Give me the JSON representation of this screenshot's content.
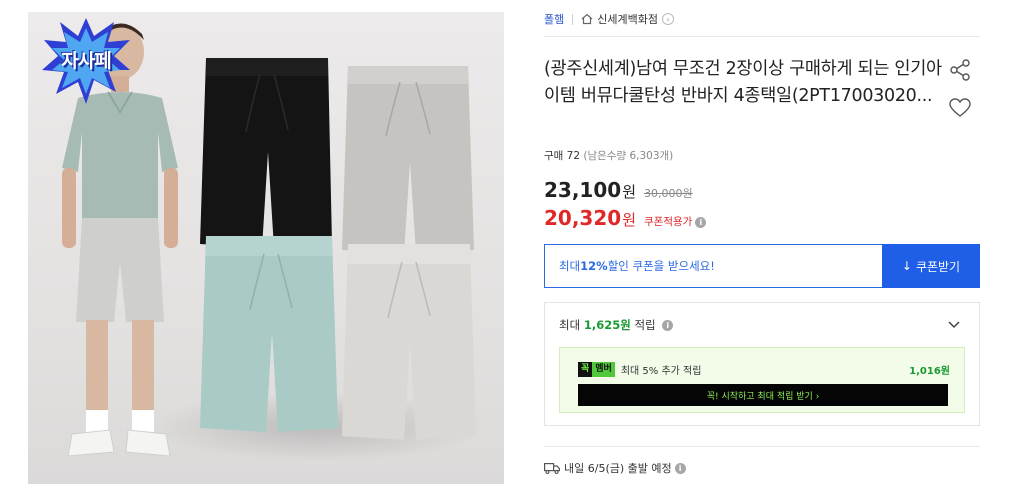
{
  "image": {
    "badge_text": "자사페"
  },
  "breadcrumb": {
    "brand": "폴햄",
    "store": "신세계백화점",
    "store_chevron": "›"
  },
  "product": {
    "title": "(광주신세계)남여 무조건 2장이상 구매하게 되는 인기아이템 버뮤다쿨탄성 반바지 4종택일(2PT17003020...",
    "purchase_label": "구매 72",
    "remaining_label": "(남은수량 6,303개)"
  },
  "price": {
    "current": "23,100",
    "currency": "원",
    "original": "30,000원",
    "coupon_price": "20,320",
    "coupon_currency": "원",
    "coupon_note": "쿠폰적용가",
    "info_glyph": "i"
  },
  "coupon": {
    "msg_prefix": "최대 ",
    "msg_percent": "12%",
    "msg_suffix": " 할인 쿠폰을 받으세요!",
    "button_label": "쿠폰받기",
    "button_icon": "↓"
  },
  "points": {
    "prefix": "최대 ",
    "amount": "1,625원",
    "suffix": " 적립",
    "info_glyph": "i",
    "member_badge_a": "꼭",
    "member_badge_b": "멤버",
    "member_text": "최대 5% 추가 적립",
    "member_amount": "1,016원",
    "member_cta": "꼭! 시작하고 최대 적립 받기 ›"
  },
  "shipping": {
    "text": "내일 6/5(금) 출발 예정",
    "info_glyph": "i"
  },
  "colors": {
    "accent_blue": "#1f5ee6",
    "sale_red": "#e02828",
    "point_green": "#1a9a32"
  }
}
